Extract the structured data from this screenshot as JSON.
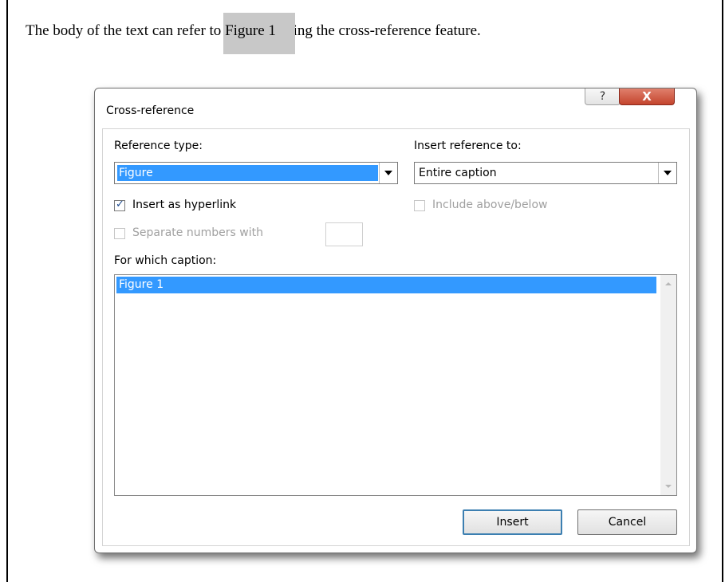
{
  "document": {
    "text_before": "The body of the text can refer to ",
    "field_text": "Figure 1",
    "text_after": " using the cross-reference feature."
  },
  "dialog": {
    "title": "Cross-reference",
    "help_glyph": "?",
    "close_glyph": "X",
    "reference_type_label": "Reference type:",
    "reference_type_value": "Figure",
    "insert_reference_to_label": "Insert reference to:",
    "insert_reference_to_value": "Entire caption",
    "insert_as_hyperlink_label": "Insert as hyperlink",
    "insert_as_hyperlink_checked": true,
    "include_above_below_label": "Include above/below",
    "separate_numbers_label": "Separate numbers with",
    "separate_numbers_value": "",
    "which_caption_label": "For which caption:",
    "captions": [
      "Figure 1"
    ],
    "insert_button": "Insert",
    "cancel_button": "Cancel"
  },
  "colors": {
    "selection": "#3399ff",
    "close_button": "#c4442d",
    "field_shading": "#c8c8c8"
  }
}
